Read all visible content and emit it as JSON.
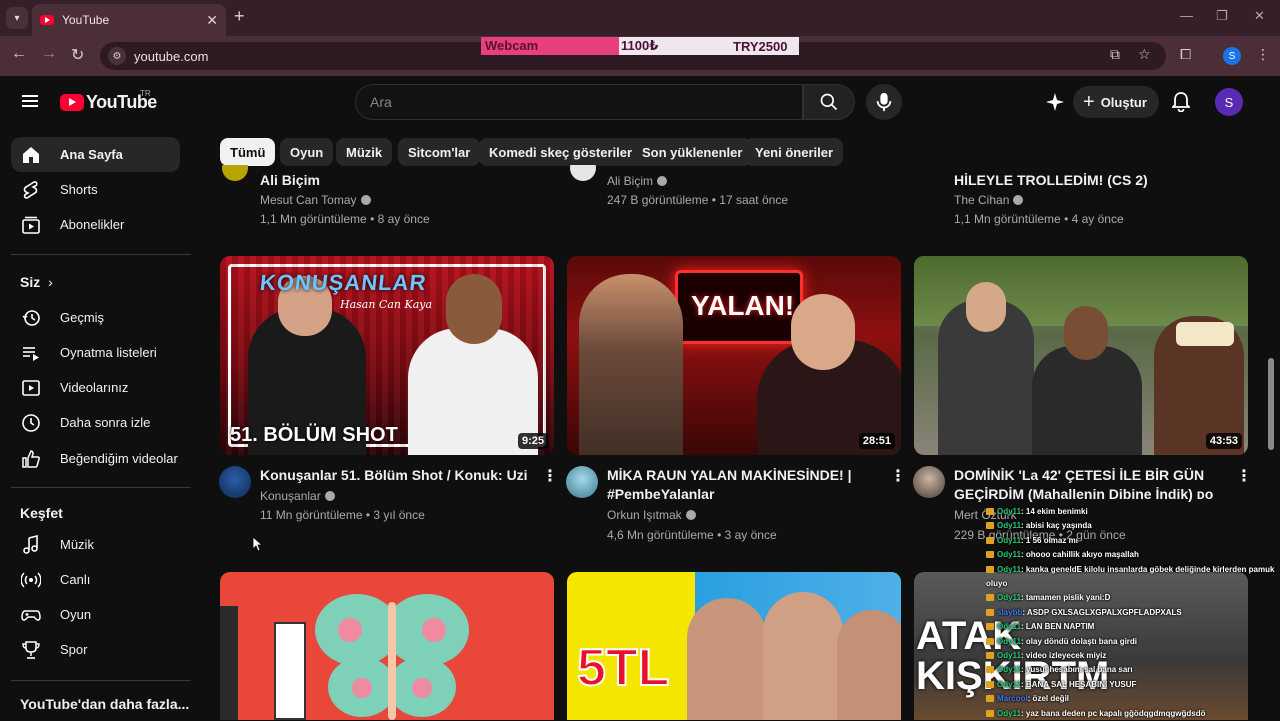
{
  "browser": {
    "tab_title": "YouTube",
    "url": "youtube.com",
    "profile_initial": "S",
    "new_tab": "+",
    "close_tab": "✕"
  },
  "overlay": {
    "label": "Webcam",
    "amount": "1100₺",
    "currency": "TRY2500"
  },
  "header": {
    "logo_text": "YouTube",
    "country": "TR",
    "search_placeholder": "Ara",
    "create_label": "Oluştur",
    "avatar_initial": "S"
  },
  "sidebar": {
    "main": [
      {
        "label": "Ana Sayfa",
        "icon": "home-icon"
      },
      {
        "label": "Shorts",
        "icon": "shorts-icon"
      },
      {
        "label": "Abonelikler",
        "icon": "subscriptions-icon"
      }
    ],
    "you_title": "Siz",
    "you": [
      {
        "label": "Geçmiş",
        "icon": "history-icon"
      },
      {
        "label": "Oynatma listeleri",
        "icon": "playlists-icon"
      },
      {
        "label": "Videolarınız",
        "icon": "your-videos-icon"
      },
      {
        "label": "Daha sonra izle",
        "icon": "watch-later-icon"
      },
      {
        "label": "Beğendiğim videolar",
        "icon": "liked-icon"
      }
    ],
    "explore_title": "Keşfet",
    "explore": [
      {
        "label": "Müzik",
        "icon": "music-icon"
      },
      {
        "label": "Canlı",
        "icon": "live-icon"
      },
      {
        "label": "Oyun",
        "icon": "gaming-icon"
      },
      {
        "label": "Spor",
        "icon": "sports-icon"
      }
    ],
    "more_title": "YouTube'dan daha fazla..."
  },
  "chips": [
    "Tümü",
    "Oyun",
    "Müzik",
    "Sitcom'lar",
    "Komedi skeç gösterileri",
    "Son yüklenenler",
    "Yeni öneriler"
  ],
  "top_row": [
    {
      "title": "Ali Biçim",
      "channel": "Mesut Can Tomay",
      "meta": "1,1 Mn görüntüleme • 8 ay önce"
    },
    {
      "title": "",
      "channel": "Ali Biçim",
      "meta": "247 B görüntüleme • 17 saat önce"
    },
    {
      "title": "HİLEYLE TROLLEDİM! (CS 2)",
      "channel": "The Cihan",
      "meta": "1,1 Mn görüntüleme • 4 ay önce"
    }
  ],
  "videos": [
    {
      "title_1": "Konuşanlar 51. Bölüm Shot / Konuk: Uzi",
      "title_2": "",
      "channel": "Konuşanlar",
      "meta": "11 Mn görüntüleme • 3 yıl önce",
      "duration": "9:25",
      "thumb_title": "KONUŞANLAR",
      "thumb_sub": "Hasan Can Kaya",
      "thumb_banner": "51. BÖLÜM SHOT"
    },
    {
      "title_1": "MİKA RAUN YALAN MAKİNESİNDE! |",
      "title_2": "#PembeYalanlar",
      "channel": "Orkun Işıtmak",
      "meta": "4,6 Mn görüntüleme • 3 ay önce",
      "duration": "28:51",
      "thumb_title": "YALAN!"
    },
    {
      "title_1": "DOMİNİK 'La 42' ÇETESİ İLE BİR GÜN",
      "title_2": "GEÇİRDİM (Mahallenin Dibine İndik) ᴅᴏ",
      "channel": "Mert Öztürk",
      "meta": "229 B görüntüleme • 2 gün önce",
      "duration": "43:53"
    }
  ],
  "bottom_row": [
    {
      "thumb_text": ""
    },
    {
      "thumb_text": "5TL"
    },
    {
      "thumb_text_1": "ATAK",
      "thumb_text_2": "KIŞKIRTM"
    }
  ],
  "chat": [
    {
      "user": "Ody11",
      "msg": ": 14 ekim benimki"
    },
    {
      "user": "Ody11",
      "msg": ": abisi kaç yaşında"
    },
    {
      "user": "Ody11",
      "msg": ": 1 56 olmaz mı"
    },
    {
      "user": "Ody11",
      "msg": ": ohooo cahillik akıyo maşallah"
    },
    {
      "user": "Ody11",
      "msg": ": kanka geneldE kilolu insanlarda göbek deliğinde kirlerden pamuk"
    },
    {
      "user": "",
      "msg": "oluyo"
    },
    {
      "user": "Ody11",
      "msg": ": tamamen pislik yani:D"
    },
    {
      "user": "slaybb",
      "msg": ": ASDP GXLSAGLXGPALXGPFLADPXALS"
    },
    {
      "user": "Ody11",
      "msg": ": LAN BEN NAPTIM"
    },
    {
      "user": "Ody11",
      "msg": ": olay döndü dolaştı bana girdi"
    },
    {
      "user": "Ody11",
      "msg": ": video izleyecek miyiz"
    },
    {
      "user": "Ody11",
      "msg": ": yusuf hesabını sal bana sarı"
    },
    {
      "user": "Ody11",
      "msg": ": BANA SAL HESABINI YUSUF"
    },
    {
      "user": "Marcool",
      "msg": ": özel değil"
    },
    {
      "user": "Ody11",
      "msg": ": yaz bana deden pc kapalı gğödqgdmqgwğdsdö"
    }
  ]
}
